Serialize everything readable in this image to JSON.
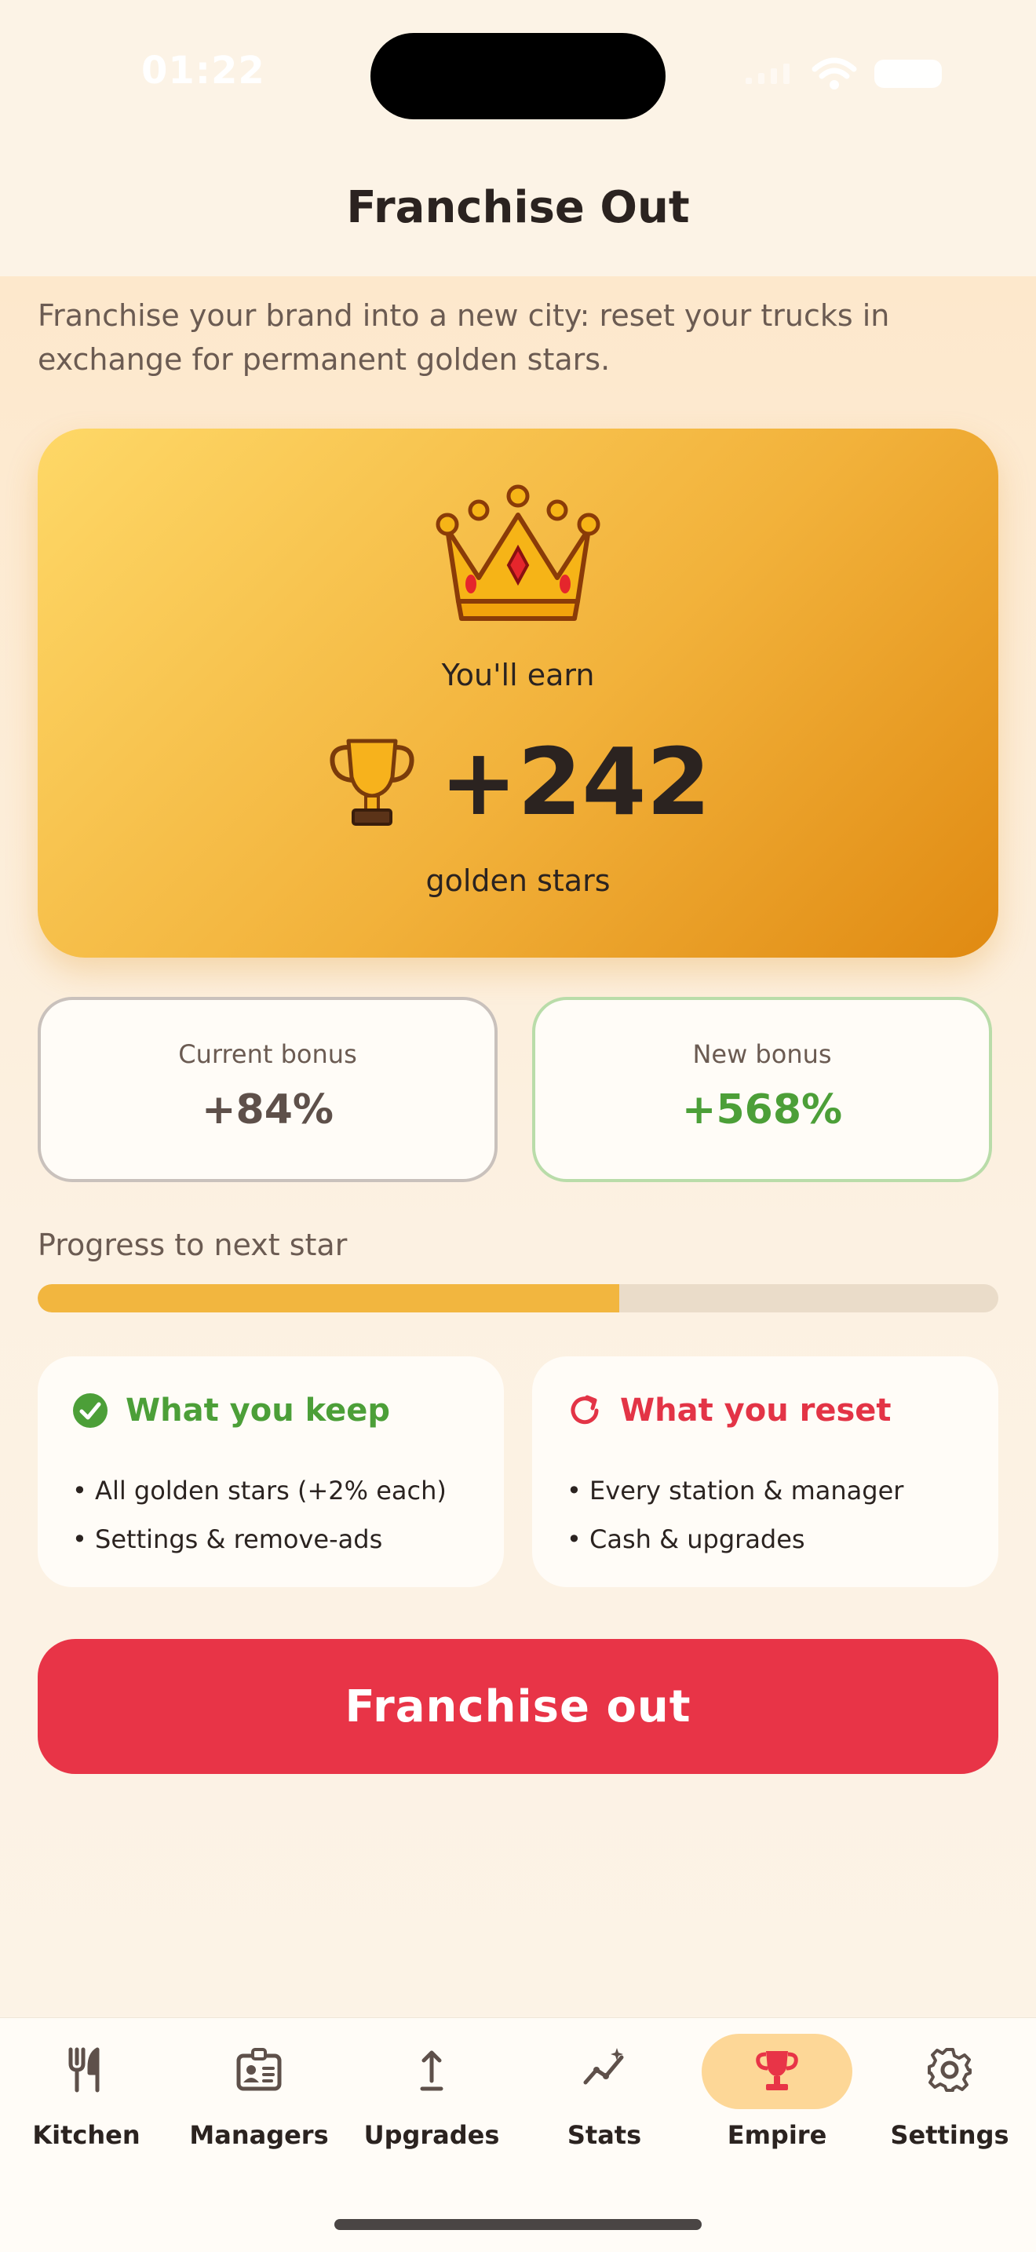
{
  "status_bar": {
    "time": "01:22"
  },
  "header": {
    "title": "Franchise Out"
  },
  "intro": "Franchise your brand into a new city: reset your trucks in exchange for permanent golden stars.",
  "hero": {
    "earn_label": "You'll earn",
    "earn_value": "+242",
    "stars_label": "golden stars"
  },
  "bonus": {
    "current_label": "Current bonus",
    "current_value": "+84%",
    "new_label": "New bonus",
    "new_value": "+568%"
  },
  "progress": {
    "label": "Progress to next star",
    "fraction": 0.605
  },
  "keep": {
    "title": "What you keep",
    "items": [
      "• All golden stars (+2% each)",
      "• Settings & remove-ads"
    ]
  },
  "reset": {
    "title": "What you reset",
    "items": [
      "• Every station & manager",
      "• Cash & upgrades"
    ]
  },
  "primary_button": "Franchise out",
  "tabs": [
    {
      "label": "Kitchen",
      "icon": "fork-knife-icon"
    },
    {
      "label": "Managers",
      "icon": "id-badge-icon"
    },
    {
      "label": "Upgrades",
      "icon": "arrow-up-icon"
    },
    {
      "label": "Stats",
      "icon": "chart-line-icon"
    },
    {
      "label": "Empire",
      "icon": "trophy-icon",
      "active": true
    },
    {
      "label": "Settings",
      "icon": "gear-icon"
    }
  ],
  "colors": {
    "accent_red": "#e83447",
    "keep_green": "#4c9f38",
    "gold": "#f2b63f",
    "active_tab_pill": "#fdd797"
  }
}
